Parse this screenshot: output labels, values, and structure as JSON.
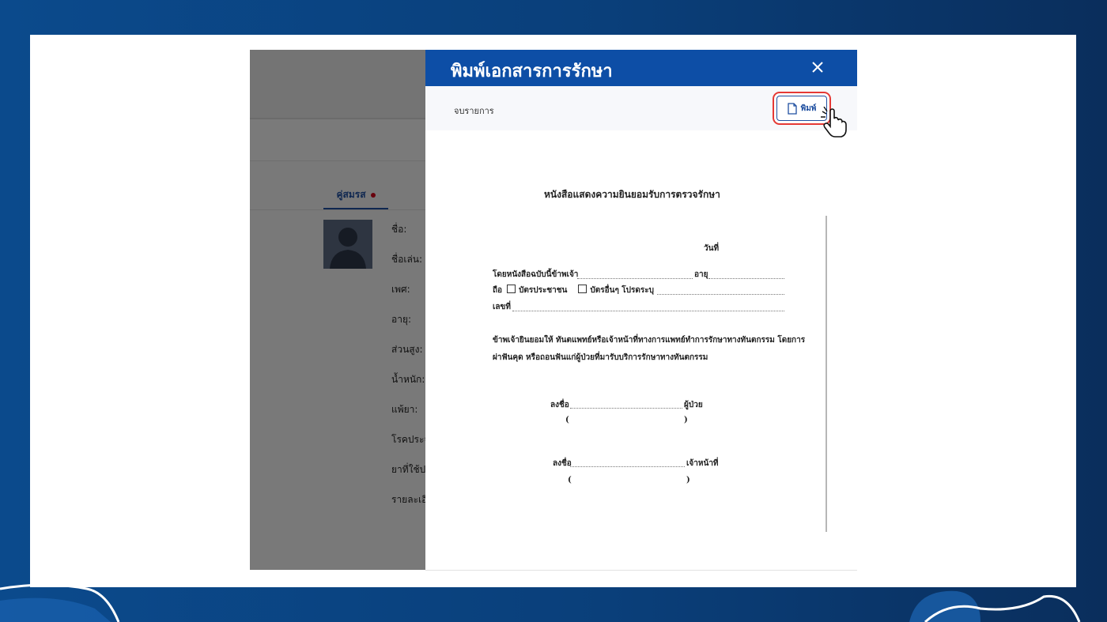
{
  "background_app": {
    "tab_label": "คู่สมรส",
    "fields": [
      "ชื่อ:",
      "ชื่อเล่น:",
      "เพศ:",
      "อายุ:",
      "ส่วนสูง:",
      "น้ำหนัก:",
      "แพ้ยา:",
      "โรคประจ",
      "ยาที่ใช้ป",
      "รายละเอี"
    ]
  },
  "dialog": {
    "title": "พิมพ์เอกสารการรักษา",
    "close_symbol": "×",
    "bar_label": "จบรายการ",
    "print_button_label": "พิมพ์"
  },
  "document": {
    "title": "หนังสือแสดงความยินยอมรับการตรวจรักษา",
    "date_label": "วันที่",
    "line1_prefix": "โดยหนังสือฉบับนี้ข้าพเจ้า",
    "age_label": "อายุ",
    "hold_label": "ถือ",
    "option_id_card": "บัตรประชาชน",
    "option_other": "บัตรอื่นๆ โปรดระบุ",
    "number_label": "เลขที่",
    "consent_line1": "ข้าพเจ้ายินยอมให้ ทันตแพทย์หรือเจ้าหน้าที่ทางการแพทย์ทำการรักษาทางทันตกรรม โดยการ",
    "consent_line2": "ผ่าฟันคุด หรือถอนฟันแก่ผู้ป่วยที่มารับบริการรักษาทางทันตกรรม",
    "sign_label": "ลงชื่อ",
    "patient_label": "ผู้ป่วย",
    "officer_label": "เจ้าหน้าที่",
    "paren_open": "(",
    "paren_close": ")"
  },
  "colors": {
    "header_blue": "#0d4ea6",
    "highlight_red": "#e53935",
    "page_bg": "#0a3f7a"
  },
  "icons": {
    "close": "close-icon",
    "print": "document-icon",
    "cursor": "pointing-hand-cursor-icon",
    "avatar": "user-silhouette-icon"
  }
}
